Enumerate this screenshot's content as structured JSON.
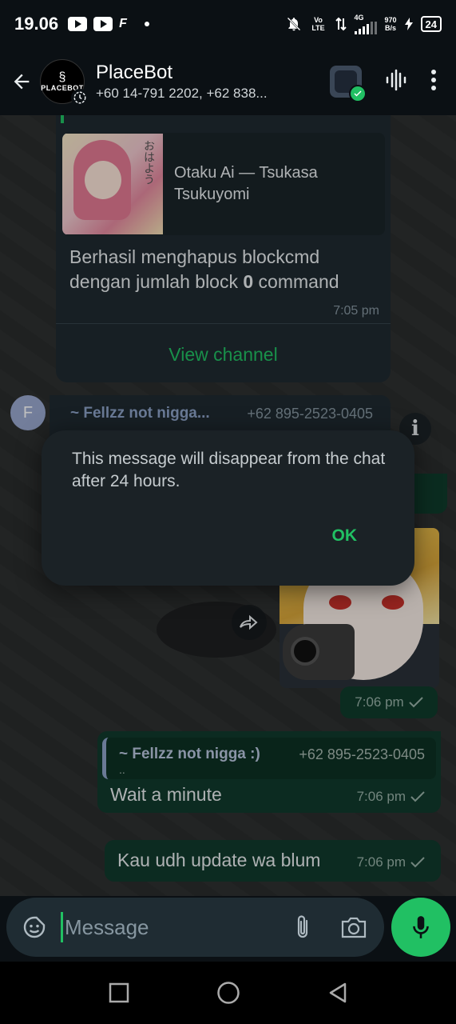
{
  "status_bar": {
    "time": "19.06",
    "net_speed_value": "970",
    "net_speed_unit": "B/s",
    "battery": "24",
    "network_type": "4G",
    "volte": "Vo LTE"
  },
  "header": {
    "title": "PlaceBot",
    "subtitle": "+60 14-791 2202, +62 838...",
    "avatar_text": "PLACEBOT"
  },
  "channel_card": {
    "preview_title": "Otaku Ai — Tsukasa Tsukuyomi",
    "thumb_kana": "おはよう",
    "text_prefix": "Berhasil menghapus blockcmd dengan jumlah block ",
    "text_count": "0",
    "text_suffix": " command",
    "time": "7:05 pm",
    "action": "View channel"
  },
  "incoming_message": {
    "avatar_letter": "F",
    "author": "~ Fellzz not nigga...",
    "phone": "+62 895-2523-0405"
  },
  "dialog": {
    "text": "This message will disappear from the chat after 24 hours.",
    "ok_label": "OK"
  },
  "image_message": {
    "time": "7:06 pm"
  },
  "reply_message": {
    "quote_author": "~ Fellzz not nigga :)",
    "quote_phone": "+62 895-2523-0405",
    "quote_text": "..",
    "text": "Wait a minute",
    "time": "7:06 pm"
  },
  "last_message": {
    "text": "Kau udh update wa blum",
    "time": "7:06 pm"
  },
  "composer": {
    "placeholder": "Message"
  },
  "colors": {
    "accent": "#21c063",
    "outgoing_bubble": "#103a2c",
    "incoming_bubble": "#1f2a30",
    "background": "#0b1014"
  }
}
